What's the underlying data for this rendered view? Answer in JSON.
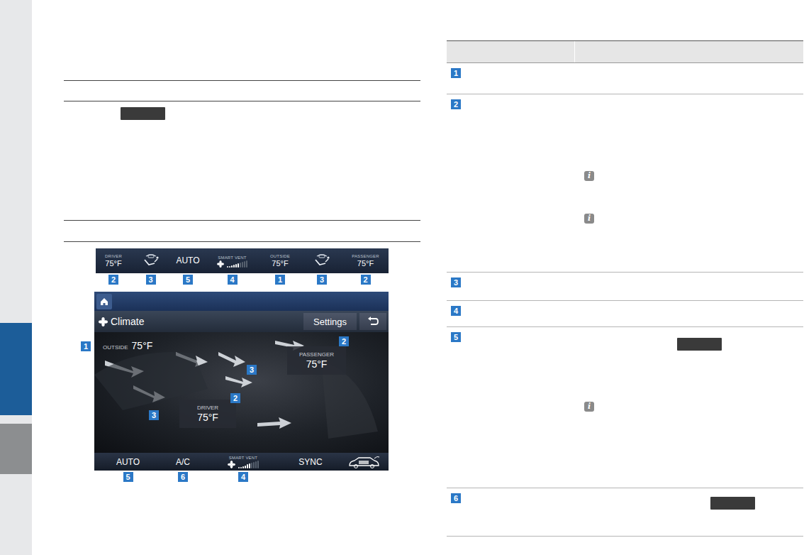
{
  "sidebar": {
    "tabs": [
      {
        "selected": true
      },
      {
        "selected": false
      }
    ]
  },
  "status_bar": {
    "items": [
      {
        "kind": "temp",
        "label": "DRIVER",
        "value": "75°F"
      },
      {
        "kind": "seat"
      },
      {
        "kind": "mode",
        "label": "AUTO"
      },
      {
        "kind": "fan",
        "label": "SMART VENT",
        "level": 0.6
      },
      {
        "kind": "temp",
        "label": "OUTSIDE",
        "value": "75°F"
      },
      {
        "kind": "seat"
      },
      {
        "kind": "temp",
        "label": "PASSENGER",
        "value": "75°F"
      }
    ],
    "badges": [
      "2",
      "3",
      "5",
      "4",
      "1",
      "3",
      "2"
    ]
  },
  "climate_screen": {
    "title": "Climate",
    "settings": "Settings",
    "outside": {
      "label": "OUTSIDE",
      "value": "75°F"
    },
    "passenger": {
      "label": "PASSENGER",
      "value": "75°F"
    },
    "driver": {
      "label": "DRIVER",
      "value": "75°F"
    },
    "overlay_badges": [
      "1",
      "2",
      "3",
      "2",
      "3"
    ],
    "bottom": [
      {
        "kind": "button",
        "label": "AUTO",
        "badge": "5"
      },
      {
        "kind": "button",
        "label": "A/C",
        "badge": "6"
      },
      {
        "kind": "fan",
        "label": "SMART VENT",
        "level": 0.6,
        "badge": "4"
      },
      {
        "kind": "button",
        "label": "SYNC",
        "badge": ""
      },
      {
        "kind": "co2",
        "badge": ""
      }
    ]
  },
  "table": {
    "rows": [
      {
        "badge": "1",
        "notes": [],
        "tag": false
      },
      {
        "badge": "2",
        "notes": [
          "i",
          "i"
        ],
        "tag": false
      },
      {
        "badge": "3",
        "notes": [],
        "tag": false
      },
      {
        "badge": "4",
        "notes": [],
        "tag": false
      },
      {
        "badge": "5",
        "notes": [
          "i"
        ],
        "tag": true
      },
      {
        "badge": "6",
        "notes": [],
        "tag": true
      }
    ]
  }
}
